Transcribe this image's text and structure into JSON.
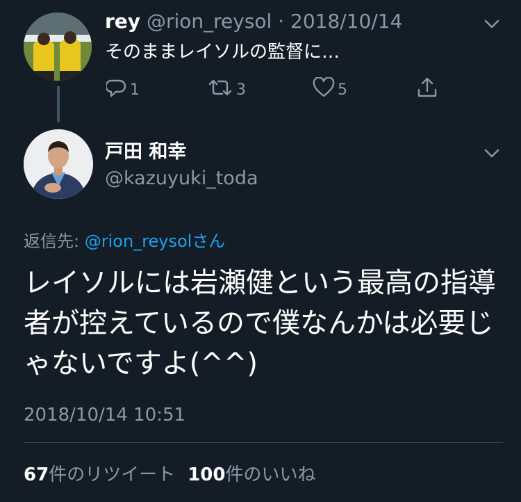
{
  "parent_tweet": {
    "name": "rey",
    "handle": "@rion_reysol",
    "separator": " · ",
    "date": "2018/10/14",
    "text": "そのままレイソルの監督に…",
    "actions": {
      "reply_count": "1",
      "retweet_count": "3",
      "like_count": "5"
    },
    "icons": [
      "reply-icon",
      "retweet-icon",
      "like-icon",
      "share-icon",
      "chevron-down-icon"
    ]
  },
  "main_tweet": {
    "name": "戸田 和幸",
    "handle": "@kazuyuki_toda",
    "reply_prefix": "返信先: ",
    "reply_to": "@rion_reysol",
    "reply_suffix": "さん",
    "text": "レイソルには岩瀬健という最高の指導者が控えているので僕なんかは必要じゃないですよ(^^)",
    "timestamp": "2018/10/14 10:51",
    "stats": {
      "retweets_count": "67",
      "retweets_label": "件のリツイート",
      "likes_count": "100",
      "likes_label": "件のいいね"
    }
  },
  "colors": {
    "background": "#141d26",
    "text_primary": "#ffffff",
    "text_secondary": "#8899a6",
    "link": "#1da1f2",
    "divider": "#38444d"
  }
}
